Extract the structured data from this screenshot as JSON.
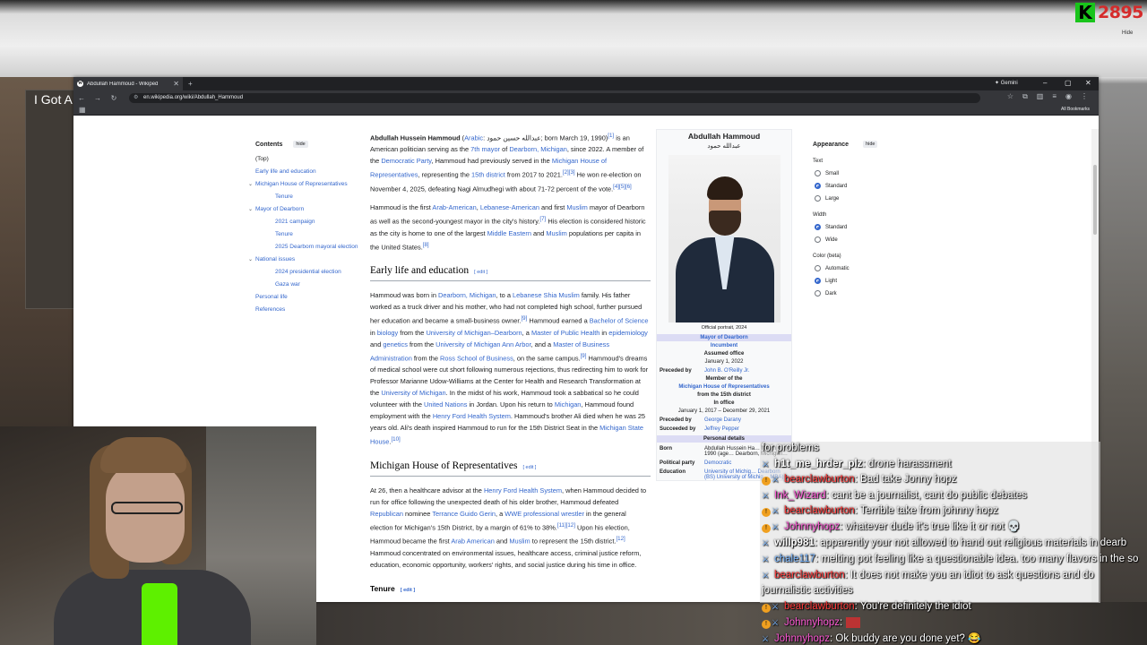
{
  "overlay": {
    "k_logo": "K",
    "k_count": "2895",
    "hide_label": "Hide",
    "bg_window_text": "I Got A"
  },
  "browser": {
    "tab_title": "Abdullah Hammoud - Wikiped",
    "favicon": "W",
    "new_tab": "+",
    "gemini": "✦ Gemini",
    "url": "en.wikipedia.org/wiki/Abdullah_Hammoud",
    "all_bookmarks": "All Bookmarks"
  },
  "toc": {
    "title": "Contents",
    "hide": "hide",
    "items": [
      {
        "label": "(Top)"
      },
      {
        "label": "Early life and education"
      },
      {
        "label": "Michigan House of Representatives"
      },
      {
        "label": "Tenure"
      },
      {
        "label": "Mayor of Dearborn"
      },
      {
        "label": "2021 campaign"
      },
      {
        "label": "Tenure"
      },
      {
        "label": "2025 Dearborn mayoral election"
      },
      {
        "label": "National issues"
      },
      {
        "label": "2024 presidential election"
      },
      {
        "label": "Gaza war"
      },
      {
        "label": "Personal life"
      },
      {
        "label": "References"
      }
    ]
  },
  "article": {
    "p1": {
      "name": "Abdullah Hussein Hammoud",
      "t1": " (",
      "arabic_link": "Arabic",
      "t2": ": عبدالله حسين حمود; born March 19, 1990)",
      "sup1": "[1]",
      "t3": " is an American politician serving as the ",
      "mayor_link": "7th mayor",
      "t4": " of ",
      "dearborn_link": "Dearborn, Michigan",
      "t5": ", since 2022. A member of the ",
      "party_link": "Democratic Party",
      "t6": ", Hammoud had previously served in the ",
      "house_link": "Michigan House of Representatives",
      "t7": ", representing the ",
      "district_link": "15th district",
      "t8": " from 2017 to 2021.",
      "sup2": "[2][3]",
      "t9": " He won re-election on November 4, 2025, defeating Nagi Almudhegi with about 71-72 percent of the vote.",
      "sup3": "[4][5][6]"
    },
    "p2": {
      "t1": "Hammoud is the first ",
      "link1": "Arab-American",
      "t2": ", ",
      "link2": "Lebanese-American",
      "t3": " and first ",
      "link3": "Muslim",
      "t4": " mayor of Dearborn as well as the second-youngest mayor in the city's history.",
      "sup1": "[7]",
      "t5": " His election is considered historic as the city is home to one of the largest ",
      "link4": "Middle Eastern",
      "t6": " and ",
      "link5": "Muslim",
      "t7": " populations per capita in the United States.",
      "sup2": "[8]"
    },
    "h_early": "Early life and education",
    "edit": "[ edit ]",
    "p3": {
      "t1": "Hammoud was born in ",
      "link1": "Dearborn, Michigan",
      "t2": ", to a ",
      "link2": "Lebanese Shia Muslim",
      "t3": " family. His father worked as a truck driver and his mother, who had not completed high school, further pursued her education and became a small-business owner.",
      "sup1": "[9]",
      "t4": " Hammoud earned a ",
      "link3": "Bachelor of Science",
      "t5": " in ",
      "link4": "biology",
      "t6": " from the ",
      "link5": "University of Michigan–Dearborn",
      "t7": ", a ",
      "link6": "Master of Public Health",
      "t8": " in ",
      "link7": "epidemiology",
      "t9": " and ",
      "link8": "genetics",
      "t10": " from the ",
      "link9": "University of Michigan Ann Arbor",
      "t11": ", and a ",
      "link10": "Master of Business Administration",
      "t12": " from the ",
      "link11": "Ross School of Business",
      "t13": ", on the same campus.",
      "sup2": "[9]",
      "t14": " Hammoud's dreams of medical school were cut short following numerous rejections, thus redirecting him to work for Professor Marianne Udow-Williams at the Center for Health and Research Transformation at the ",
      "link12": "University of Michigan",
      "t15": ". In the midst of his work, Hammoud took a sabbatical so he could volunteer with the ",
      "link13": "United Nations",
      "t16": " in Jordan. Upon his return to ",
      "link14": "Michigan",
      "t17": ", Hammoud found employment with the ",
      "link15": "Henry Ford Health System",
      "t18": ". Hammoud's brother Ali died when he was 25 years old. Ali's death inspired Hammoud to run for the 15th District Seat in the ",
      "link16": "Michigan State House",
      "t19": ".",
      "sup3": "[10]"
    },
    "h_house": "Michigan House of Representatives",
    "p4": {
      "t1": "At 26, then a healthcare advisor at the ",
      "link1": "Henry Ford Health System",
      "t2": ", when Hammoud decided to run for office following the unexpected death of his older brother, Hammoud defeated ",
      "link2": "Republican",
      "t3": " nominee ",
      "link3": "Terrance Guido Gerin",
      "t4": ", a ",
      "link4": "WWE professional wrestler",
      "t5": " in the general election for Michigan's 15th District, by a margin of 61% to 38%.",
      "sup1": "[11][12]",
      "t6": " Upon his election, Hammoud became the first ",
      "link5": "Arab American",
      "t7": " and ",
      "link6": "Muslim",
      "t8": " to represent the 15th district.",
      "sup2": "[12]",
      "t9": " Hammoud concentrated on environmental issues, healthcare access, criminal justice reform, education, economic opportunity, workers' rights, and social justice during his time in office."
    },
    "h_tenure": "Tenure"
  },
  "infobox": {
    "name": "Abdullah Hammoud",
    "arabic": "عبدالله حمود",
    "caption": "Official portrait, 2024",
    "band1": "Mayor of Dearborn",
    "band1_sub": "Incumbent",
    "assumed": "Assumed office",
    "assumed_date": "January 1, 2022",
    "preceded_lbl": "Preceded by",
    "preceded_val": "John B. O'Reilly Jr.",
    "member_line1": "Member of the",
    "member_link": "Michigan House of Representatives",
    "member_line3": "from the 15th district",
    "in_office": "In office",
    "in_office_dates": "January 1, 2017 – December 29, 2021",
    "preceded2_val": "George Darany",
    "succeeded_lbl": "Succeeded by",
    "succeeded_val": "Jeffrey Pepper",
    "personal": "Personal details",
    "born_lbl": "Born",
    "born_val": "Abdullah Hussein Ha… March 19, 1990 (age… Dearborn, Michigan…",
    "party_lbl": "Political party",
    "party_val": "Democratic",
    "edu_lbl": "Education",
    "edu_val": "University of Michig… Dearborn (BS) University of Michig… MBA)"
  },
  "appearance": {
    "title": "Appearance",
    "hide": "hide",
    "text_label": "Text",
    "text_opts": [
      {
        "label": "Small",
        "on": false
      },
      {
        "label": "Standard",
        "on": true
      },
      {
        "label": "Large",
        "on": false
      }
    ],
    "width_label": "Width",
    "width_opts": [
      {
        "label": "Standard",
        "on": true
      },
      {
        "label": "Wide",
        "on": false
      }
    ],
    "color_label": "Color (beta)",
    "color_opts": [
      {
        "label": "Automatic",
        "on": false
      },
      {
        "label": "Light",
        "on": true
      },
      {
        "label": "Dark",
        "on": false
      }
    ]
  },
  "chat": {
    "messages": [
      {
        "user": "",
        "text": "for problems"
      },
      {
        "user": "h1t_me_hrder_plz",
        "text": ": drone harassment"
      },
      {
        "user": "bearclawburton",
        "text": ": Bad take Jonny hopz"
      },
      {
        "user": "Ink_Wizard",
        "text": ": cant be a journalist, cant do public debates"
      },
      {
        "user": "bearclawburton",
        "text": ": Terrible take from johnny hopz"
      },
      {
        "user": "Johnnyhopz",
        "text": ": whatever dude it's true like it or not 💀"
      },
      {
        "user": "willp981",
        "text": ": apparently your not allowed to hand out religious materials in dearb"
      },
      {
        "user": "chale117",
        "text": ": melting pot feeling like a questionable idea. too many flavors in the so"
      },
      {
        "user": "bearclawburton",
        "text": ": It does not make you an idiot to ask questions and do"
      },
      {
        "user": "",
        "text": "journalistic activities"
      },
      {
        "user": "bearclawburton",
        "text": ": You're definitely the idiot"
      },
      {
        "user": "Johnnyhopz",
        "text": ":"
      },
      {
        "user": "Johnnyhopz",
        "text": ": Ok buddy are you done yet? 😂"
      }
    ]
  },
  "colors": {
    "link": "#3366cc",
    "chat_red": "#ff3b3b",
    "chat_pink": "#ff5ad7",
    "k_green": "#19c41b",
    "k_red": "#d52b2b",
    "can_green": "#5ef000"
  }
}
